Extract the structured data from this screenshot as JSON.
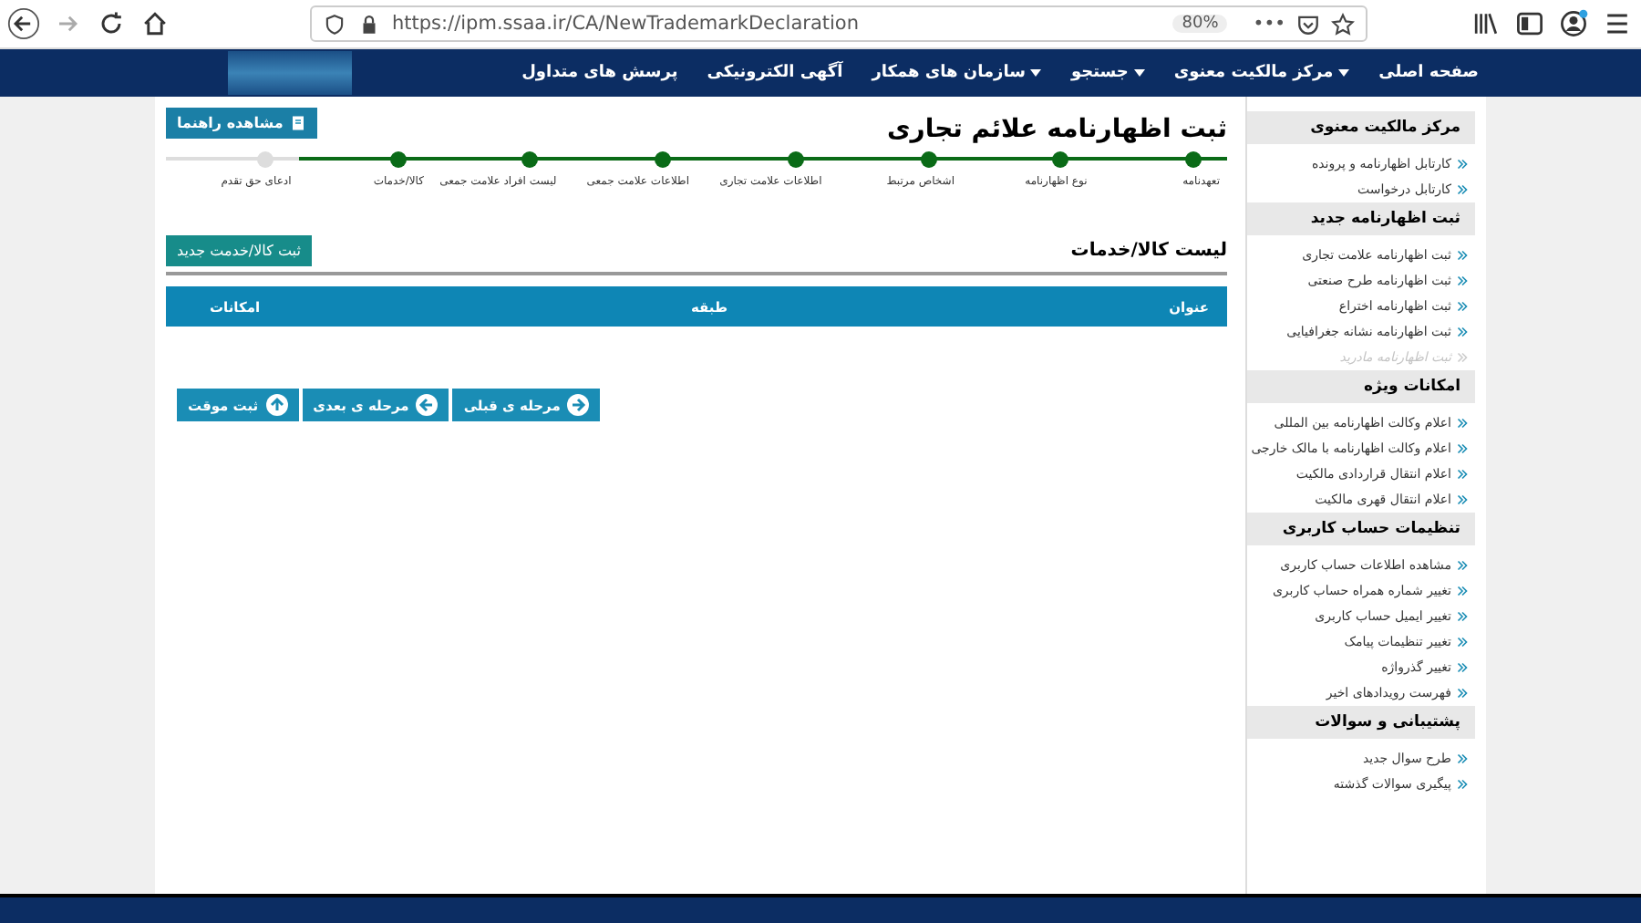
{
  "browser": {
    "url": "https://ipm.ssaa.ir/CA/NewTrademarkDeclaration",
    "zoom": "80%",
    "menu_glyph": "•••"
  },
  "nav": [
    {
      "label": "صفحه اصلی",
      "has_menu": false
    },
    {
      "label": "مرکز مالکیت معنوی",
      "has_menu": true
    },
    {
      "label": "جستجو",
      "has_menu": true
    },
    {
      "label": "سازمان های همکار",
      "has_menu": true
    },
    {
      "label": "آگهی الکترونیکی",
      "has_menu": false
    },
    {
      "label": "پرسش های متداول",
      "has_menu": false
    }
  ],
  "sidebar": [
    {
      "title": "مرکز مالکیت معنوی",
      "items": [
        {
          "label": "کارتابل اظهارنامه و پرونده",
          "disabled": false
        },
        {
          "label": "کارتابل درخواست",
          "disabled": false
        }
      ]
    },
    {
      "title": "ثبت اظهارنامه جدید",
      "items": [
        {
          "label": "ثبت اظهارنامه علامت تجاری",
          "disabled": false
        },
        {
          "label": "ثبت اظهارنامه طرح صنعتی",
          "disabled": false
        },
        {
          "label": "ثبت اظهارنامه اختراع",
          "disabled": false
        },
        {
          "label": "ثبت اظهارنامه نشانه جغرافیایی",
          "disabled": false
        },
        {
          "label": "ثبت اظهارنامه مادرید",
          "disabled": true
        }
      ]
    },
    {
      "title": "امکانات ویژه",
      "items": [
        {
          "label": "اعلام وکالت اظهارنامه بین المللی",
          "disabled": false
        },
        {
          "label": "اعلام وکالت اظهارنامه با مالک خارجی",
          "disabled": false
        },
        {
          "label": "اعلام انتقال قراردادی مالکیت",
          "disabled": false
        },
        {
          "label": "اعلام انتقال قهری مالکیت",
          "disabled": false
        }
      ]
    },
    {
      "title": "تنظیمات حساب کاربری",
      "items": [
        {
          "label": "مشاهده اطلاعات حساب کاربری",
          "disabled": false
        },
        {
          "label": "تغییر شماره همراه حساب کاربری",
          "disabled": false
        },
        {
          "label": "تغییر ایمیل حساب کاربری",
          "disabled": false
        },
        {
          "label": "تغییر تنظیمات پیامک",
          "disabled": false
        },
        {
          "label": "تغییر گذرواژه",
          "disabled": false
        },
        {
          "label": "فهرست رویدادهای اخیر",
          "disabled": false
        }
      ]
    },
    {
      "title": "پشتیبانی و سوالات",
      "items": [
        {
          "label": "طرح سوال جدید",
          "disabled": false
        },
        {
          "label": "پیگیری سوالات گذشته",
          "disabled": false
        }
      ]
    }
  ],
  "page_title": "ثبت اظهارنامه علائم تجاری",
  "guide_button": "مشاهده راهنما",
  "steps": [
    {
      "label": "تعهدنامه",
      "done": true
    },
    {
      "label": "نوع اظهارنامه",
      "done": true
    },
    {
      "label": "اشخاص مرتبط",
      "done": true
    },
    {
      "label": "اطلاعات علامت تجاری",
      "done": true
    },
    {
      "label": "اطلاعات علامت جمعی",
      "done": true
    },
    {
      "label": "لیست افراد علامت جمعی",
      "done": true
    },
    {
      "label": "کالا/خدمات",
      "done": true
    },
    {
      "label": "ادعای حق تقدم",
      "done": false
    }
  ],
  "list": {
    "title": "لیست کالا/خدمات",
    "add_button": "ثبت کالا/خدمت جدید",
    "columns": [
      "عنوان",
      "طبقه",
      "امکانات"
    ]
  },
  "actions": [
    {
      "label": "مرحله ی قبلی",
      "kind": "right"
    },
    {
      "label": "مرحله ی بعدی",
      "kind": "left"
    },
    {
      "label": "ثبت موقت",
      "kind": "up"
    }
  ]
}
